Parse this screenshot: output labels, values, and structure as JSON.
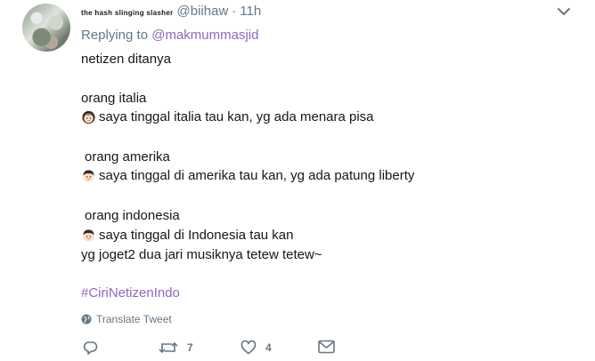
{
  "tweet": {
    "display_name": "the hash slinging slasher",
    "handle": "@biihaw",
    "separator": "·",
    "time": "11h",
    "replying_prefix": "Replying to",
    "replying_to": "@makmummasjid",
    "lines": [
      "netizen ditanya",
      "orang italia",
      "saya tinggal italia tau kan, yg ada menara pisa",
      "orang amerika",
      "saya tinggal di amerika tau kan, yg ada patung liberty",
      "orang indonesia",
      "saya tinggal di Indonesia tau kan",
      "yg joget2 dua jari musiknya tetew tetew~"
    ],
    "hashtag": "#CiriNetizenIndo",
    "translate_label": "Translate Tweet"
  },
  "actions": {
    "reply_count": "",
    "retweet_count": "7",
    "like_count": "4"
  },
  "icons": [
    "avatar",
    "chevron-down-icon",
    "girl-emoji",
    "boy-emoji",
    "globe-icon",
    "reply-icon",
    "retweet-icon",
    "heart-icon",
    "message-icon"
  ],
  "colors": {
    "link": "#8f67c2",
    "muted": "#657786",
    "text": "#14171a"
  }
}
